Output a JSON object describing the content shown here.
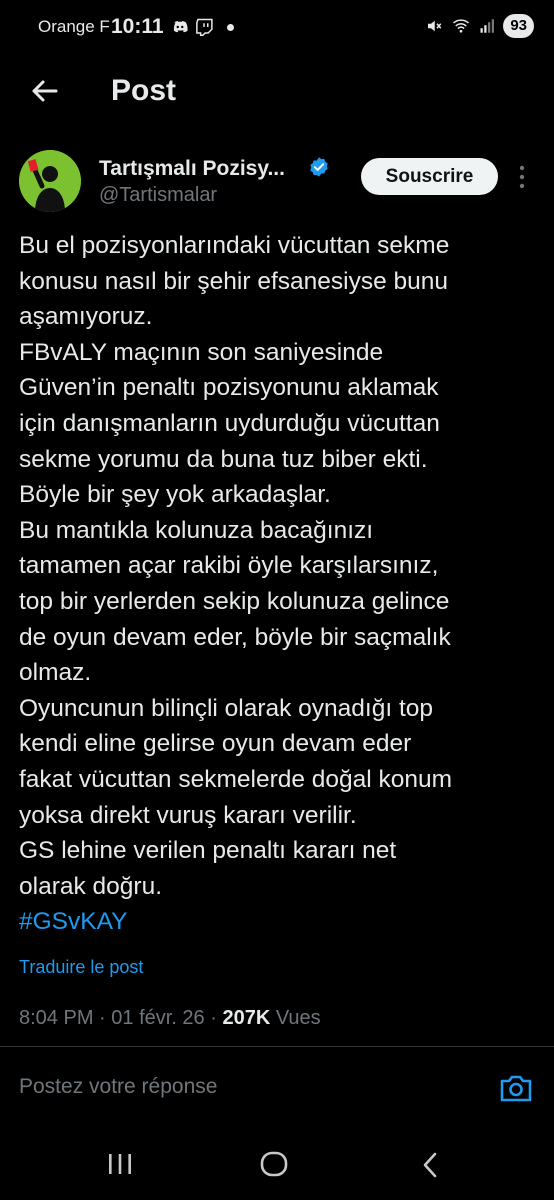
{
  "status_bar": {
    "carrier": "Orange F",
    "time": "10:11",
    "battery": "93",
    "icons": [
      "discord-icon",
      "twitch-icon",
      "mute-icon",
      "wifi-icon",
      "signal-icon"
    ]
  },
  "header": {
    "title": "Post",
    "back_icon": "arrow-left-icon"
  },
  "author": {
    "name": "Tartışmalı Pozisy...",
    "handle": "@Tartismalar",
    "verified": true,
    "subscribe_label": "Souscrire"
  },
  "tweet": {
    "lines": [
      "Bu el pozisyonlarındaki vücuttan sekme",
      "konusu nasıl bir şehir efsanesiyse bunu",
      "aşamıyoruz.",
      "FBvALY maçının son saniyesinde",
      "Güven’in penaltı pozisyonunu aklamak",
      "için danışmanların uydurduğu vücuttan",
      "sekme yorumu da buna tuz biber ekti.",
      "Böyle bir şey yok arkadaşlar.",
      "Bu mantıkla kolunuza bacağınızı",
      "tamamen açar rakibi öyle karşılarsınız,",
      "top bir yerlerden sekip kolunuza gelince",
      "de oyun devam eder, böyle bir saçmalık",
      "olmaz.",
      "Oyuncunun bilinçli olarak oynadığı top",
      "kendi eline gelirse oyun devam eder",
      "fakat vücuttan sekmelerde doğal konum",
      "yoksa direkt vuruş kararı verilir.",
      "GS lehine verilen penaltı kararı net",
      "olarak doğru."
    ],
    "hashtag": "#GSvKAY",
    "translate_label": "Traduire le post",
    "time": "8:04 PM",
    "date": "01 févr. 26",
    "views_count": "207K",
    "views_label": "Vues"
  },
  "reply": {
    "placeholder": "Postez votre réponse"
  },
  "colors": {
    "background": "#000000",
    "text": "#e7e9ea",
    "secondary": "#71767b",
    "accent": "#1d9bf0",
    "avatar_bg": "#7cc130"
  }
}
